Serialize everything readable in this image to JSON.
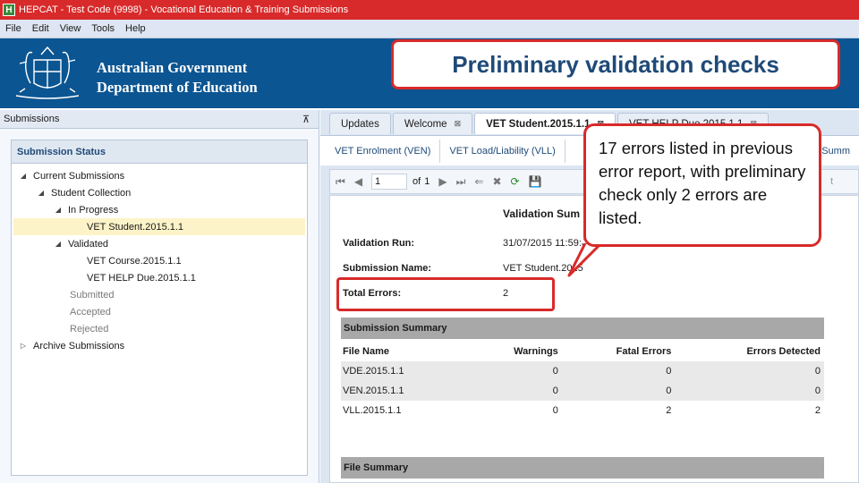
{
  "window": {
    "title": "HEPCAT - Test Code (9998) - Vocational Education & Training Submissions",
    "app_icon_letter": "H"
  },
  "menu": [
    "File",
    "Edit",
    "View",
    "Tools",
    "Help"
  ],
  "banner": {
    "line1": "Australian Government",
    "line2": "Department of Education"
  },
  "overlay": {
    "heading": "Preliminary validation checks",
    "callout": "17 errors listed in previous error report, with preliminary check only 2 errors are listed."
  },
  "left_panel": {
    "header": "Submissions",
    "pin_glyph": "⊼",
    "status_header": "Submission Status",
    "tree": [
      {
        "label": "Current Submissions",
        "toggle": "◢"
      },
      {
        "label": "Student Collection",
        "toggle": "◢"
      },
      {
        "label": "In Progress",
        "toggle": "◢"
      },
      {
        "label": "VET Student.2015.1.1",
        "toggle": ""
      },
      {
        "label": "Validated",
        "toggle": "◢"
      },
      {
        "label": "VET Course.2015.1.1",
        "toggle": ""
      },
      {
        "label": "VET HELP Due.2015.1.1",
        "toggle": ""
      },
      {
        "label": "Submitted",
        "toggle": ""
      },
      {
        "label": "Accepted",
        "toggle": ""
      },
      {
        "label": "Rejected",
        "toggle": ""
      },
      {
        "label": "Archive Submissions",
        "toggle": "▷"
      }
    ]
  },
  "tabs": [
    {
      "label": "Updates"
    },
    {
      "label": "Welcome",
      "close": "⊠"
    },
    {
      "label": "VET Student.2015.1.1",
      "close": "⊠"
    },
    {
      "label": "VET HELP Due.2015.1.1",
      "close": "⊠"
    }
  ],
  "subtabs": [
    "VET Enrolment (VEN)",
    "VET Load/Liability (VLL)",
    "Summ"
  ],
  "toolbar": {
    "first": "⏮",
    "prev": "◀",
    "page": "1",
    "of_label": "of",
    "total_pages": "1",
    "next": "▶",
    "last": "⏭",
    "back": "⇐",
    "stop": "✖",
    "refresh": "⟳",
    "save": "💾",
    "trailing_letter": "t"
  },
  "report": {
    "title": "Validation Sum",
    "run_label": "Validation Run:",
    "run_value": "31/07/2015 11:59:0",
    "name_label": "Submission Name:",
    "name_value": "VET Student.2015",
    "errors_label": "Total Errors:",
    "errors_value": "2",
    "summary_header": "Submission Summary",
    "file_summary_header": "File Summary",
    "columns": [
      "File Name",
      "Warnings",
      "Fatal Errors",
      "Errors Detected"
    ],
    "rows": [
      [
        "VDE.2015.1.1",
        "0",
        "0",
        "0"
      ],
      [
        "VEN.2015.1.1",
        "0",
        "0",
        "0"
      ],
      [
        "VLL.2015.1.1",
        "0",
        "2",
        "2"
      ]
    ]
  }
}
